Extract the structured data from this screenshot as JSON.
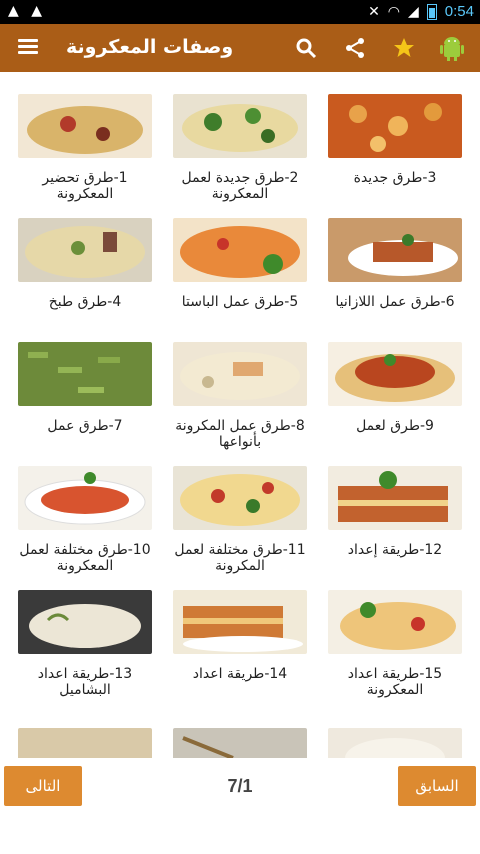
{
  "status": {
    "time": "0:54",
    "left_icons": "▲ ▲"
  },
  "app": {
    "title": "وصفات المعكرونة"
  },
  "items": [
    {
      "label": "1-طرق تحضير المعكرونة"
    },
    {
      "label": "2-طرق جديدة لعمل المعكرونة"
    },
    {
      "label": "3-طرق جديدة"
    },
    {
      "label": "4-طرق طبخ"
    },
    {
      "label": "5-طرق عمل الباستا"
    },
    {
      "label": "6-طرق عمل اللازانيا"
    },
    {
      "label": "7-طرق عمل"
    },
    {
      "label": "8-طرق عمل المكرونة بأنواعها"
    },
    {
      "label": "9-طرق لعمل"
    },
    {
      "label": "10-طرق مختلفة لعمل المعكرونة"
    },
    {
      "label": "11-طرق مختلفة لعمل المكرونة"
    },
    {
      "label": "12-طريقة إعداد"
    },
    {
      "label": "13-طريقة اعداد البشاميل"
    },
    {
      "label": "14-طريقة اعداد"
    },
    {
      "label": "15-طريقة اعداد المعكرونة"
    }
  ],
  "pagination": {
    "next_label": "التالى",
    "prev_label": "السابق",
    "page": "7/1"
  },
  "colors": {
    "app_bar": "#aa5d17",
    "button": "#dd8a30"
  }
}
